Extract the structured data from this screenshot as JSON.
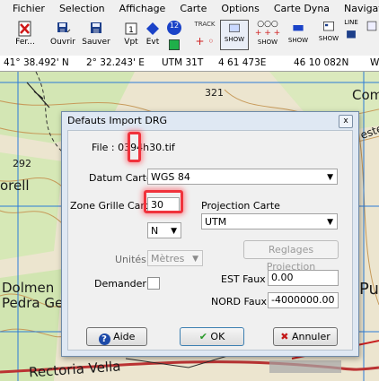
{
  "menu": [
    "Fichier",
    "Selection",
    "Affichage",
    "Carte",
    "Options",
    "Carte Dyna",
    "Navigation"
  ],
  "toolbar": {
    "fermer": "Fer...",
    "ouvrir": "Ouvrir",
    "sauver": "Sauver",
    "vpt": "Vpt",
    "evt": "Evt",
    "track": "TRACK",
    "show": "SHOW",
    "line": "LINE",
    "num": "12"
  },
  "coords": {
    "lat": "41° 38.492' N",
    "lon": "2° 32.243' E",
    "utm": "UTM  31T",
    "easting": "4 61 473E",
    "northing": "46 10 082N",
    "extra": "W"
  },
  "map_labels": {
    "n321": "321",
    "n292": "292",
    "orell": "orell",
    "dolmen": "Dolmen",
    "pedra": "Pedra Ge",
    "rectoria": "Rectoria Vella",
    "com": "Com",
    "este": "este",
    "pu": "Pu"
  },
  "dialog": {
    "title": "Defauts Import DRG",
    "close": "x",
    "file_label": "File : 0394h30.tif",
    "datum_label": "Datum Carte",
    "datum_value": "WGS 84",
    "zone_label": "Zone Grille Carte",
    "zone_value": "30",
    "hemisphere": "N",
    "projection_label": "Projection Carte",
    "projection_value": "UTM",
    "reglages_button": "Reglages Projection",
    "unites_label": "Unités",
    "unites_value": "Mètres",
    "demander_label": "Demander",
    "est_label": "EST Faux",
    "est_value": "0.00",
    "nord_label": "NORD Faux",
    "nord_value": "-4000000.00",
    "aide": "Aide",
    "ok": "OK",
    "annuler": "Annuler"
  }
}
